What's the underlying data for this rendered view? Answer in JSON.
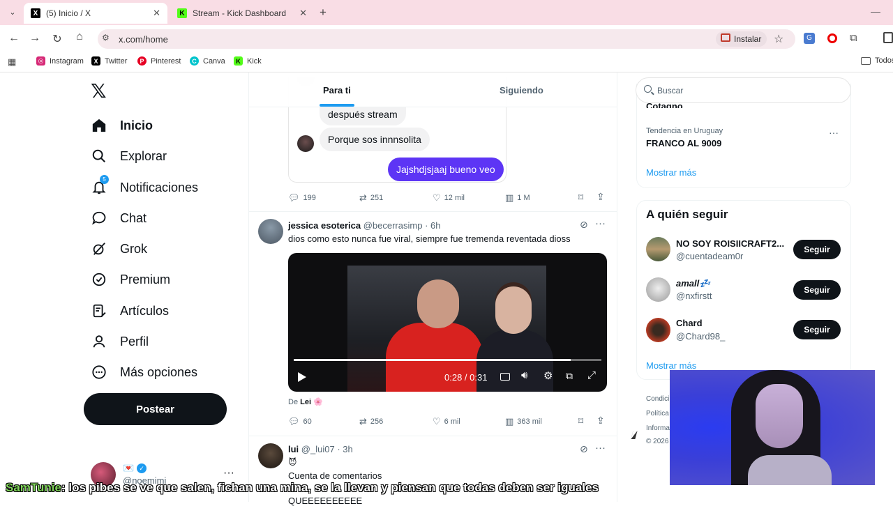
{
  "browser": {
    "tabs": [
      {
        "title": "(5) Inicio / X"
      },
      {
        "title": "Stream - Kick Dashboard"
      }
    ],
    "url": "x.com/home",
    "install_label": "Instalar",
    "bookmarks": [
      "Instagram",
      "Twitter",
      "Pinterest",
      "Canva",
      "Kick"
    ],
    "bookmarks_folder": "Todos"
  },
  "sidebar": {
    "items": [
      {
        "label": "Inicio",
        "icon": "home-icon"
      },
      {
        "label": "Explorar",
        "icon": "search-icon"
      },
      {
        "label": "Notificaciones",
        "icon": "bell-icon",
        "badge": "5"
      },
      {
        "label": "Chat",
        "icon": "chat-icon"
      },
      {
        "label": "Grok",
        "icon": "grok-icon"
      },
      {
        "label": "Premium",
        "icon": "premium-icon"
      },
      {
        "label": "Artículos",
        "icon": "articles-icon"
      },
      {
        "label": "Perfil",
        "icon": "person-icon"
      },
      {
        "label": "Más opciones",
        "icon": "more-icon"
      }
    ],
    "post_label": "Postear",
    "account": {
      "handle": "@noemimi",
      "display_emoji": "💌"
    }
  },
  "feed": {
    "tabs": [
      "Para ti",
      "Siguiendo"
    ],
    "post1": {
      "bubbles": [
        "después stream",
        "Porque sos innnsolita",
        "Jajshdjsjaaj bueno veo"
      ],
      "replies": "199",
      "reposts": "251",
      "likes": "12 mil",
      "views": "1 M"
    },
    "post2": {
      "name": "jessica esoterica",
      "handle": "@becerrasimp",
      "time": "· 6h",
      "text": "dios como esto nunca fue viral, siempre fue tremenda reventada dioss",
      "video_time": "0:28 / 0:31",
      "video_progress": 0.9,
      "from_label": "De",
      "from_name": "Lei 🌸",
      "replies": "60",
      "reposts": "256",
      "likes": "6 mil",
      "views": "363 mil"
    },
    "post3": {
      "name": "lui",
      "handle": "@_lui07",
      "time": "· 3h",
      "emoji": "😈",
      "text": "Cuenta de comentarios",
      "text2": "QUEEEEEEEEEE"
    }
  },
  "right": {
    "search_placeholder": "Buscar",
    "trend_partial": "Cotagno",
    "trend_context": "Tendencia en Uruguay",
    "trend_name": "FRANCO AL 9009",
    "show_more": "Mostrar más",
    "who_to_follow_title": "A quién seguir",
    "suggestions": [
      {
        "name": "NO SOY ROISIICRAFT2...",
        "handle": "@cuentadeam0r"
      },
      {
        "name": "amall💤",
        "handle": "@nxfirstt"
      },
      {
        "name": "Chard",
        "handle": "@Chard98_"
      }
    ],
    "follow_label": "Seguir",
    "show_more_2": "Mostrar más",
    "footer": [
      "Condici",
      "Política",
      "Informa",
      "© 2026"
    ]
  },
  "overlay": {
    "subtitle_user": "SamTunie",
    "subtitle_text": ": los pibes se ve que salen, fichan una mina, se la llevan y piensan que todas deben ser iguales"
  },
  "colors": {
    "accent": "#1d9bf0",
    "purple": "#5d35f5",
    "text": "#0f1419",
    "muted": "#536471"
  }
}
